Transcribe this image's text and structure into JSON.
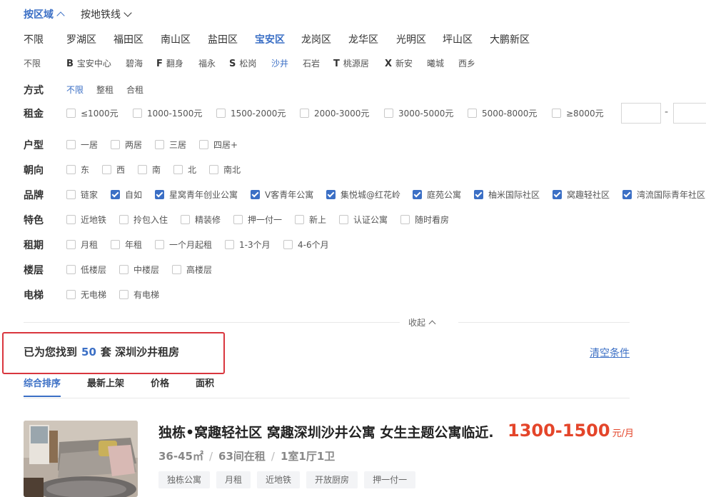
{
  "top_tabs": {
    "district": "按区域",
    "metro": "按地铁线"
  },
  "districts": {
    "all": "不限",
    "items": [
      "罗湖区",
      "福田区",
      "南山区",
      "盐田区",
      "宝安区",
      "龙岗区",
      "龙华区",
      "光明区",
      "坪山区",
      "大鹏新区"
    ]
  },
  "subareas": {
    "all": "不限",
    "items": [
      {
        "letter": "B",
        "label": "宝安中心"
      },
      {
        "letter": "",
        "label": "碧海"
      },
      {
        "letter": "F",
        "label": "翻身"
      },
      {
        "letter": "",
        "label": "福永"
      },
      {
        "letter": "S",
        "label": "松岗"
      },
      {
        "letter": "",
        "label": "沙井"
      },
      {
        "letter": "",
        "label": "石岩"
      },
      {
        "letter": "T",
        "label": "桃源居"
      },
      {
        "letter": "X",
        "label": "新安"
      },
      {
        "letter": "",
        "label": "曦城"
      },
      {
        "letter": "",
        "label": "西乡"
      }
    ]
  },
  "method": {
    "label": "方式",
    "options": [
      "不限",
      "整租",
      "合租"
    ]
  },
  "rent": {
    "label": "租金",
    "options": [
      "≤1000元",
      "1000-1500元",
      "1500-2000元",
      "2000-3000元",
      "3000-5000元",
      "5000-8000元",
      "≥8000元"
    ],
    "range_sep": "-"
  },
  "layout": {
    "label": "户型",
    "options": [
      "一居",
      "两居",
      "三居",
      "四居+"
    ]
  },
  "orientation": {
    "label": "朝向",
    "options": [
      "东",
      "西",
      "南",
      "北",
      "南北"
    ]
  },
  "brand": {
    "label": "品牌",
    "options": [
      "链家",
      "自如",
      "星窝青年创业公寓",
      "V客青年公寓",
      "集悦城@红花岭",
      "庭苑公寓",
      "柚米国际社区",
      "窝趣轻社区",
      "湾流国际青年社区"
    ],
    "checked": [
      false,
      true,
      true,
      true,
      true,
      true,
      true,
      true,
      true
    ]
  },
  "features": {
    "label": "特色",
    "options": [
      "近地铁",
      "拎包入住",
      "精装修",
      "押一付一",
      "新上",
      "认证公寓",
      "随时看房"
    ]
  },
  "lease": {
    "label": "租期",
    "options": [
      "月租",
      "年租",
      "一个月起租",
      "1-3个月",
      "4-6个月"
    ]
  },
  "floor": {
    "label": "楼层",
    "options": [
      "低楼层",
      "中楼层",
      "高楼层"
    ]
  },
  "elevator": {
    "label": "电梯",
    "options": [
      "无电梯",
      "有电梯"
    ]
  },
  "collapse": {
    "label": "收起"
  },
  "result": {
    "prefix": "已为您找到",
    "count": "50",
    "suffix": "套 深圳沙井租房"
  },
  "clear": {
    "label": "清空条件"
  },
  "sort_tabs": [
    "综合排序",
    "最新上架",
    "价格",
    "面积"
  ],
  "listing": {
    "title": "独栋•窝趣轻社区 窝趣深圳沙井公寓 女生主题公寓临近.",
    "price": "1300-1500",
    "price_unit": "元/月",
    "area": "36-45㎡",
    "rooms_left": "63间在租",
    "layout": "1室1厅1卫",
    "tags": [
      "独栋公寓",
      "月租",
      "近地铁",
      "开放厨房",
      "押一付一"
    ]
  },
  "colors": {
    "accent": "#3b6fc5",
    "price": "#e4452a",
    "highlight_border": "#d9363e"
  }
}
